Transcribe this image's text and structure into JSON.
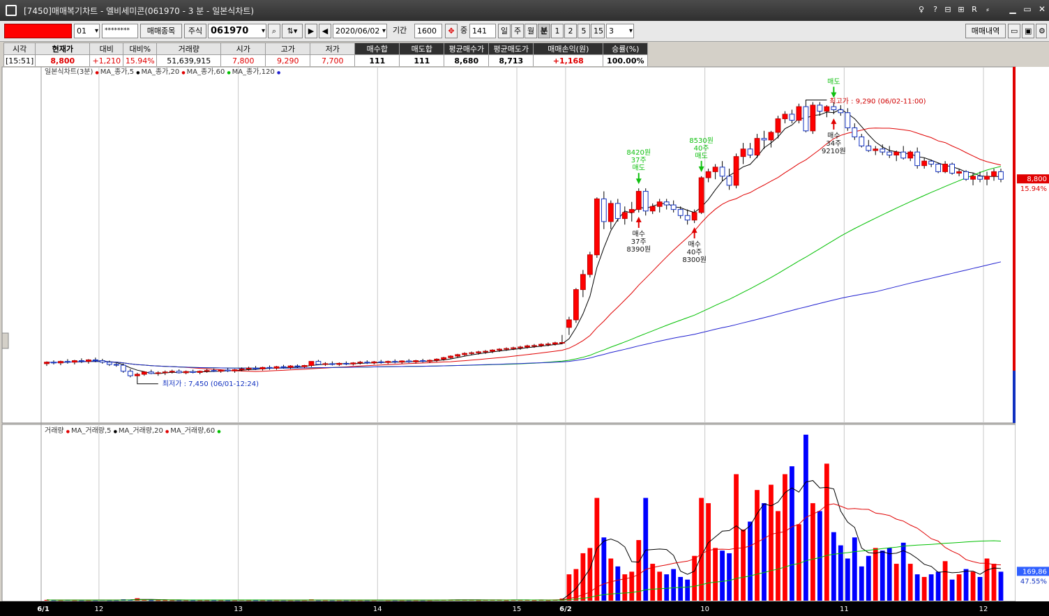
{
  "window": {
    "title": "[7450]매매복기차트 - 엘비세미콘(061970 - 3 분 - 일본식차트)",
    "title_icons": [
      "pin-icon",
      "help-icon",
      "link-icon",
      "split-icon",
      "r-icon",
      "font-icon"
    ],
    "title_icon_glyphs": [
      "♀",
      "?",
      "⊟",
      "⊞",
      "R",
      "⸗"
    ]
  },
  "toolbar": {
    "account_no": "",
    "account_sub": "01",
    "password": "********",
    "trade_item_btn": "매매종목",
    "asset_type": "주식",
    "code": "061970",
    "date": "2020/06/02",
    "period_label": "기간",
    "period": "1600",
    "mid_label": "중",
    "count": "141",
    "intervals": [
      "일",
      "주",
      "월",
      "분",
      "1",
      "2",
      "5",
      "15",
      "3"
    ],
    "selected_interval": "분",
    "history_btn": "매매내역"
  },
  "summary": {
    "headers": [
      "시각",
      "현재가",
      "대비",
      "대비%",
      "거래량",
      "시가",
      "고가",
      "저가",
      "매수합",
      "매도합",
      "평균매수가",
      "평균매도가",
      "매매손익(원)",
      "승률(%)"
    ],
    "values": [
      "[15:51]",
      "8,800",
      "+1,210",
      "15.94%",
      "51,639,915",
      "7,800",
      "9,290",
      "7,700",
      "111",
      "111",
      "8,680",
      "8,713",
      "+1,168",
      "100.00%"
    ]
  },
  "chart_data": [
    {
      "type": "candlestick",
      "title": "일본식차트(3분)",
      "legend": [
        "MA_종가,5",
        "MA_종가,20",
        "MA_종가,60",
        "MA_종가,120"
      ],
      "legend_colors": [
        "#e00000",
        "#000000",
        "#e00000",
        "#00c000",
        "#2020d0"
      ],
      "ylim": [
        7200,
        9500
      ],
      "current_price_label": "8,800",
      "current_change_label": "15.94%",
      "high_label": "최고가 : 9,290 (06/02-11:00)",
      "low_label": "최저가 : 7,450 (06/01-12:24)",
      "x_ticks": [
        {
          "label": "6/1",
          "i": 0
        },
        {
          "label": "12",
          "i": 8
        },
        {
          "label": "13",
          "i": 28
        },
        {
          "label": "14",
          "i": 48
        },
        {
          "label": "15",
          "i": 68
        },
        {
          "label": "6/2",
          "i": 75
        },
        {
          "label": "10",
          "i": 95
        },
        {
          "label": "11",
          "i": 115
        },
        {
          "label": "12",
          "i": 135
        }
      ],
      "trades": [
        {
          "i": 85,
          "side": "sell",
          "lines": [
            "8420원",
            "37주",
            "매도"
          ]
        },
        {
          "i": 85,
          "side": "buy",
          "lines": [
            "매수",
            "37주",
            "8390원"
          ]
        },
        {
          "i": 94,
          "side": "sell",
          "lines": [
            "8530원",
            "40주",
            "매도"
          ]
        },
        {
          "i": 93,
          "side": "buy",
          "lines": [
            "매수",
            "40주",
            "8300원"
          ]
        },
        {
          "i": 113,
          "side": "sell",
          "lines": [
            "매도"
          ]
        },
        {
          "i": 113,
          "side": "buy",
          "lines": [
            "매수",
            "34주",
            "9210원"
          ]
        }
      ],
      "candles": [
        [
          7560,
          7575,
          7545,
          7570
        ],
        [
          7570,
          7582,
          7555,
          7565
        ],
        [
          7565,
          7580,
          7550,
          7575
        ],
        [
          7575,
          7590,
          7560,
          7570
        ],
        [
          7570,
          7585,
          7555,
          7580
        ],
        [
          7580,
          7595,
          7565,
          7575
        ],
        [
          7575,
          7590,
          7560,
          7585
        ],
        [
          7585,
          7600,
          7570,
          7580
        ],
        [
          7580,
          7592,
          7560,
          7570
        ],
        [
          7570,
          7580,
          7545,
          7555
        ],
        [
          7555,
          7565,
          7540,
          7550
        ],
        [
          7550,
          7560,
          7500,
          7510
        ],
        [
          7510,
          7525,
          7470,
          7480
        ],
        [
          7480,
          7500,
          7450,
          7490
        ],
        [
          7490,
          7510,
          7480,
          7505
        ],
        [
          7505,
          7520,
          7490,
          7495
        ],
        [
          7495,
          7510,
          7480,
          7500
        ],
        [
          7500,
          7515,
          7485,
          7505
        ],
        [
          7505,
          7520,
          7495,
          7510
        ],
        [
          7510,
          7522,
          7495,
          7500
        ],
        [
          7500,
          7515,
          7490,
          7508
        ],
        [
          7508,
          7520,
          7496,
          7502
        ],
        [
          7502,
          7515,
          7490,
          7510
        ],
        [
          7510,
          7525,
          7500,
          7515
        ],
        [
          7515,
          7528,
          7505,
          7510
        ],
        [
          7510,
          7522,
          7500,
          7518
        ],
        [
          7518,
          7530,
          7505,
          7512
        ],
        [
          7512,
          7525,
          7500,
          7520
        ],
        [
          7520,
          7535,
          7510,
          7525
        ],
        [
          7525,
          7540,
          7515,
          7530
        ],
        [
          7530,
          7545,
          7518,
          7525
        ],
        [
          7525,
          7540,
          7515,
          7535
        ],
        [
          7535,
          7548,
          7520,
          7530
        ],
        [
          7530,
          7545,
          7520,
          7540
        ],
        [
          7540,
          7552,
          7528,
          7535
        ],
        [
          7535,
          7550,
          7525,
          7545
        ],
        [
          7545,
          7555,
          7532,
          7540
        ],
        [
          7540,
          7552,
          7530,
          7548
        ],
        [
          7548,
          7565,
          7538,
          7575
        ],
        [
          7575,
          7585,
          7550,
          7555
        ],
        [
          7555,
          7570,
          7545,
          7560
        ],
        [
          7560,
          7575,
          7548,
          7555
        ],
        [
          7555,
          7568,
          7545,
          7562
        ],
        [
          7562,
          7575,
          7550,
          7558
        ],
        [
          7558,
          7570,
          7548,
          7565
        ],
        [
          7565,
          7578,
          7555,
          7570
        ],
        [
          7570,
          7582,
          7558,
          7565
        ],
        [
          7565,
          7578,
          7555,
          7572
        ],
        [
          7572,
          7585,
          7560,
          7568
        ],
        [
          7568,
          7580,
          7558,
          7575
        ],
        [
          7575,
          7588,
          7562,
          7570
        ],
        [
          7570,
          7582,
          7560,
          7578
        ],
        [
          7578,
          7590,
          7565,
          7572
        ],
        [
          7572,
          7585,
          7562,
          7580
        ],
        [
          7580,
          7592,
          7568,
          7575
        ],
        [
          7575,
          7588,
          7565,
          7582
        ],
        [
          7582,
          7595,
          7572,
          7590
        ],
        [
          7590,
          7605,
          7580,
          7600
        ],
        [
          7600,
          7615,
          7590,
          7610
        ],
        [
          7610,
          7625,
          7598,
          7620
        ],
        [
          7620,
          7635,
          7608,
          7628
        ],
        [
          7628,
          7640,
          7615,
          7632
        ],
        [
          7632,
          7645,
          7620,
          7638
        ],
        [
          7638,
          7650,
          7625,
          7642
        ],
        [
          7642,
          7655,
          7630,
          7650
        ],
        [
          7650,
          7662,
          7638,
          7656
        ],
        [
          7656,
          7668,
          7645,
          7660
        ],
        [
          7660,
          7672,
          7650,
          7665
        ],
        [
          7665,
          7678,
          7652,
          7670
        ],
        [
          7670,
          7685,
          7660,
          7678
        ],
        [
          7678,
          7690,
          7665,
          7680
        ],
        [
          7680,
          7695,
          7670,
          7688
        ],
        [
          7688,
          7700,
          7675,
          7690
        ],
        [
          7690,
          7705,
          7680,
          7698
        ],
        [
          7698,
          7750,
          7690,
          7700
        ],
        [
          7800,
          7870,
          7750,
          7850
        ],
        [
          7850,
          8060,
          7830,
          8050
        ],
        [
          8050,
          8180,
          8000,
          8150
        ],
        [
          8150,
          8300,
          8130,
          8280
        ],
        [
          8280,
          8660,
          8260,
          8650
        ],
        [
          8650,
          8700,
          8450,
          8500
        ],
        [
          8500,
          8640,
          8450,
          8620
        ],
        [
          8620,
          8650,
          8500,
          8520
        ],
        [
          8520,
          8600,
          8480,
          8560
        ],
        [
          8560,
          8630,
          8500,
          8580
        ],
        [
          8580,
          8720,
          8560,
          8700
        ],
        [
          8700,
          8720,
          8540,
          8570
        ],
        [
          8570,
          8620,
          8550,
          8600
        ],
        [
          8600,
          8650,
          8560,
          8630
        ],
        [
          8630,
          8650,
          8580,
          8610
        ],
        [
          8610,
          8640,
          8560,
          8580
        ],
        [
          8580,
          8600,
          8520,
          8540
        ],
        [
          8540,
          8580,
          8480,
          8510
        ],
        [
          8510,
          8580,
          8490,
          8560
        ],
        [
          8560,
          8800,
          8550,
          8790
        ],
        [
          8790,
          8850,
          8760,
          8830
        ],
        [
          8830,
          8880,
          8780,
          8860
        ],
        [
          8860,
          8900,
          8770,
          8800
        ],
        [
          8800,
          8850,
          8710,
          8740
        ],
        [
          8740,
          8950,
          8720,
          8930
        ],
        [
          8930,
          9020,
          8880,
          8980
        ],
        [
          8980,
          9020,
          8920,
          8940
        ],
        [
          8940,
          9080,
          8920,
          9050
        ],
        [
          9050,
          9100,
          8980,
          9040
        ],
        [
          9040,
          9100,
          8990,
          9090
        ],
        [
          9090,
          9200,
          9050,
          9180
        ],
        [
          9180,
          9230,
          9150,
          9210
        ],
        [
          9210,
          9240,
          9150,
          9170
        ],
        [
          9170,
          9280,
          9150,
          9260
        ],
        [
          9260,
          9290,
          9090,
          9100
        ],
        [
          9100,
          9290,
          9080,
          9270
        ],
        [
          9270,
          9290,
          9200,
          9230
        ],
        [
          9230,
          9270,
          9190,
          9260
        ],
        [
          9260,
          9290,
          9210,
          9240
        ],
        [
          9240,
          9270,
          9200,
          9220
        ],
        [
          9220,
          9250,
          9100,
          9120
        ],
        [
          9120,
          9150,
          9040,
          9060
        ],
        [
          9060,
          9080,
          8990,
          9000
        ],
        [
          9000,
          9040,
          8960,
          8970
        ],
        [
          8970,
          9000,
          8940,
          8980
        ],
        [
          8980,
          9010,
          8940,
          8960
        ],
        [
          8960,
          9000,
          8920,
          8940
        ],
        [
          8940,
          8970,
          8900,
          8960
        ],
        [
          8960,
          9000,
          8910,
          8920
        ],
        [
          8920,
          8970,
          8900,
          8960
        ],
        [
          8960,
          8990,
          8850,
          8870
        ],
        [
          8870,
          8920,
          8850,
          8900
        ],
        [
          8900,
          8910,
          8860,
          8880
        ],
        [
          8880,
          8890,
          8820,
          8830
        ],
        [
          8830,
          8900,
          8820,
          8880
        ],
        [
          8880,
          8890,
          8810,
          8820
        ],
        [
          8820,
          8850,
          8800,
          8830
        ],
        [
          8830,
          8840,
          8770,
          8780
        ],
        [
          8780,
          8820,
          8740,
          8800
        ],
        [
          8800,
          8830,
          8760,
          8780
        ],
        [
          8780,
          8830,
          8740,
          8800
        ],
        [
          8800,
          8850,
          8770,
          8830
        ],
        [
          8830,
          8850,
          8760,
          8780
        ]
      ]
    },
    {
      "type": "bar",
      "title": "거래량",
      "legend": [
        "MA_거래량,5",
        "MA_거래량,20",
        "MA_거래량,60"
      ],
      "legend_colors": [
        "#e00000",
        "#000000",
        "#e00000",
        "#00c000"
      ],
      "ylim": [
        0,
        640000
      ],
      "last_value_label": "169,86",
      "last_change_label": "47.55%",
      "volumes": [
        3000,
        2000,
        2000,
        3000,
        2000,
        2000,
        2000,
        2000,
        3000,
        2000,
        2000,
        5000,
        4000,
        9000,
        3000,
        2000,
        2000,
        2000,
        2000,
        2000,
        2000,
        2000,
        2000,
        2000,
        2000,
        2000,
        2000,
        2000,
        3000,
        2000,
        2000,
        2000,
        2000,
        2000,
        2000,
        2000,
        2000,
        2000,
        5000,
        2000,
        2000,
        2000,
        2000,
        2000,
        2000,
        2000,
        2000,
        2000,
        3000,
        2000,
        2000,
        2000,
        2000,
        2000,
        2000,
        2000,
        3000,
        3000,
        4000,
        4000,
        3000,
        3000,
        2000,
        3000,
        3000,
        3000,
        2000,
        3000,
        3000,
        3000,
        2000,
        3000,
        2000,
        3000,
        8000,
        100000,
        120000,
        180000,
        200000,
        390000,
        240000,
        160000,
        130000,
        100000,
        110000,
        230000,
        390000,
        140000,
        110000,
        100000,
        120000,
        90000,
        80000,
        170000,
        390000,
        370000,
        200000,
        190000,
        180000,
        480000,
        270000,
        300000,
        420000,
        370000,
        440000,
        340000,
        480000,
        510000,
        290000,
        630000,
        370000,
        340000,
        520000,
        260000,
        210000,
        160000,
        240000,
        130000,
        170000,
        200000,
        190000,
        200000,
        140000,
        220000,
        140000,
        100000,
        90000,
        100000,
        110000,
        150000,
        80000,
        100000,
        120000,
        110000,
        90000,
        160000,
        140000,
        110000
      ]
    }
  ]
}
